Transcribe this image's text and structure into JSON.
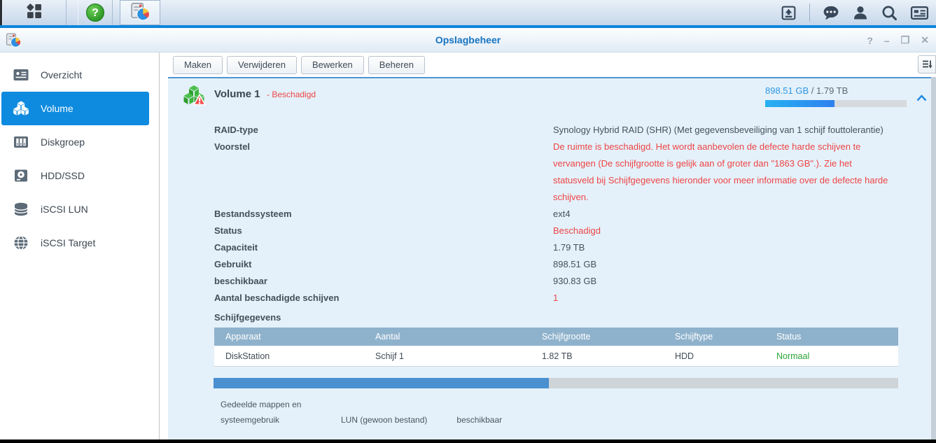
{
  "window": {
    "title": "Opslagbeheer",
    "controls": {
      "help": "?",
      "minimize": "–",
      "maximize": "❐",
      "close": "✕"
    }
  },
  "taskbar": {
    "help_glyph": "?"
  },
  "toolbar": {
    "buttons": [
      "Maken",
      "Verwijderen",
      "Bewerken",
      "Beheren"
    ]
  },
  "sidebar": {
    "items": [
      {
        "label": "Overzicht"
      },
      {
        "label": "Volume"
      },
      {
        "label": "Diskgroep"
      },
      {
        "label": "HDD/SSD"
      },
      {
        "label": "iSCSI LUN"
      },
      {
        "label": "iSCSI Target"
      }
    ]
  },
  "volume": {
    "title": "Volume 1",
    "status": "- Beschadigd",
    "capacity_used": "898.51 GB",
    "capacity_total": "/ 1.79 TB",
    "usage_percent": 49,
    "details": [
      {
        "label": "RAID-type",
        "value": "Synology Hybrid RAID (SHR) (Met gegevensbeveiliging van 1 schijf fouttolerantie)"
      },
      {
        "label": "Voorstel",
        "value": "De ruimte is beschadigd. Het wordt aanbevolen de defecte harde schijven te vervangen (De schijfgrootte is gelijk aan of groter dan \"1863 GB\".). Zie het statusveld bij Schijfgegevens hieronder voor meer informatie over de defecte harde schijven."
      },
      {
        "label": "Bestandssysteem",
        "value": "ext4"
      },
      {
        "label": "Status",
        "value": "Beschadigd"
      },
      {
        "label": "Capaciteit",
        "value": "1.79 TB"
      },
      {
        "label": "Gebruikt",
        "value": "898.51 GB"
      },
      {
        "label": "beschikbaar",
        "value": "930.83 GB"
      },
      {
        "label": "Aantal beschadigde schijven",
        "value": "1"
      }
    ],
    "disk_table": {
      "title": "Schijfgegevens",
      "columns": [
        "Apparaat",
        "Aantal",
        "Schijfgrootte",
        "Schijftype",
        "Status"
      ],
      "rows": [
        [
          "DiskStation",
          "Schijf 1",
          "1.82 TB",
          "HDD",
          "Normaal"
        ]
      ]
    },
    "legend": [
      "Gedeelde mappen en systeemgebruik",
      "LUN (gewoon bestand)",
      "beschikbaar"
    ]
  }
}
